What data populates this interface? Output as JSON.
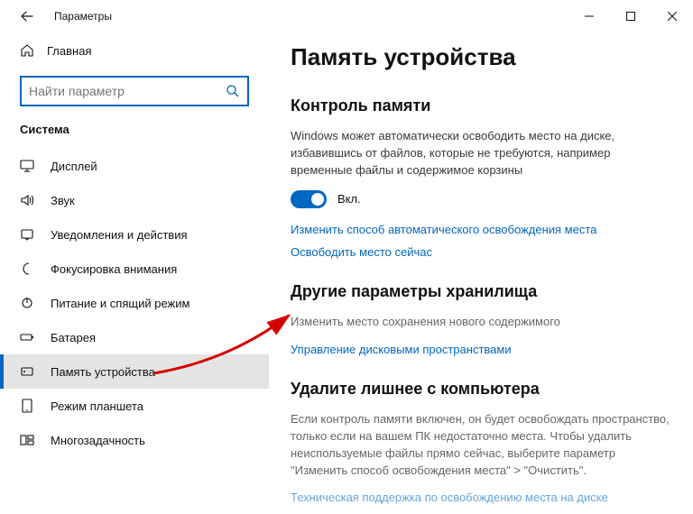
{
  "window": {
    "title": "Параметры"
  },
  "sidebar": {
    "home_label": "Главная",
    "search_placeholder": "Найти параметр",
    "section": "Система",
    "items": [
      {
        "label": "Дисплей",
        "icon": "monitor"
      },
      {
        "label": "Звук",
        "icon": "sound"
      },
      {
        "label": "Уведомления и действия",
        "icon": "notification"
      },
      {
        "label": "Фокусировка внимания",
        "icon": "moon"
      },
      {
        "label": "Питание и спящий режим",
        "icon": "power"
      },
      {
        "label": "Батарея",
        "icon": "battery"
      },
      {
        "label": "Память устройства",
        "icon": "storage"
      },
      {
        "label": "Режим планшета",
        "icon": "tablet"
      },
      {
        "label": "Многозадачность",
        "icon": "multitask"
      }
    ],
    "active_index": 6
  },
  "main": {
    "title": "Память устройства",
    "storage_sense": {
      "heading": "Контроль памяти",
      "description": "Windows может автоматически освободить место на диске, избавившись от файлов, которые не требуются, например временные файлы и содержимое корзины",
      "toggle_state": "Вкл.",
      "link_configure": "Изменить способ автоматического освобождения места",
      "link_free_now": "Освободить место сейчас"
    },
    "other_storage": {
      "heading": "Другие параметры хранилища",
      "link_change_save": "Изменить место сохранения нового содержимого",
      "link_manage_spaces": "Управление дисковыми пространствами"
    },
    "cleanup": {
      "heading": "Удалите лишнее с компьютера",
      "description": "Если контроль памяти включен, он будет освобождать пространство, только если на вашем ПК недостаточно места. Чтобы удалить неиспользуемые файлы прямо сейчас, выберите параметр \"Изменить способ освобождения места\" > \"Очистить\".",
      "link_tech": "Техническая поддержка по освобождению места на диске"
    }
  }
}
